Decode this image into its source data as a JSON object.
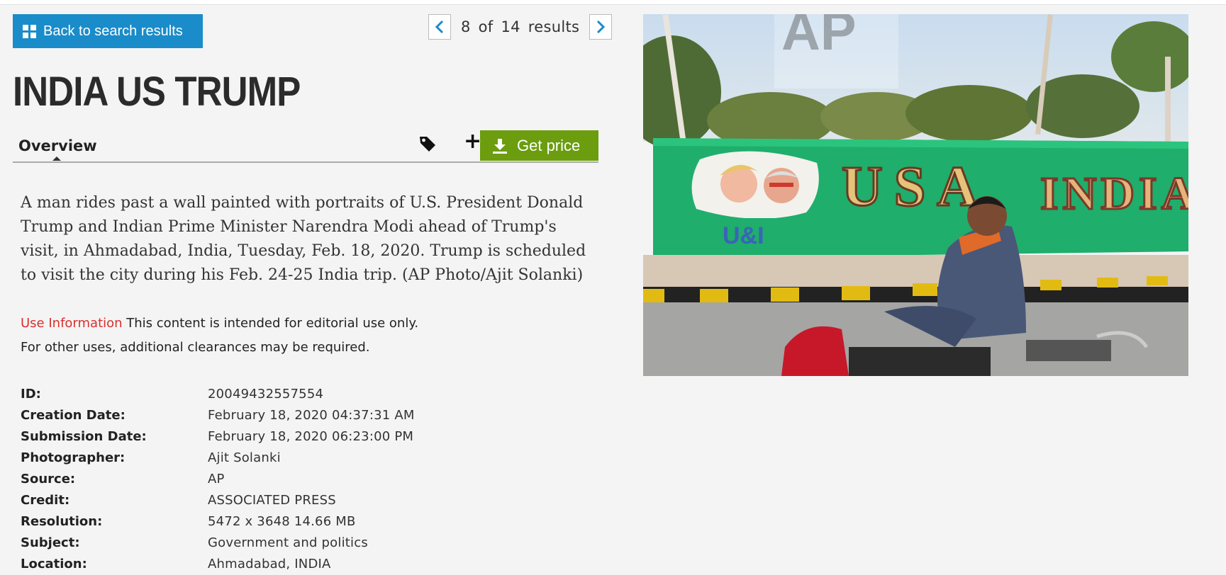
{
  "nav": {
    "back_label": "Back to search results",
    "pager": {
      "current": "8",
      "of": "of",
      "total": "14",
      "word": "results"
    }
  },
  "title": "INDIA US TRUMP",
  "tabs": {
    "overview": "Overview",
    "get_price": "Get price"
  },
  "caption": "A man rides past a wall painted with portraits of U.S. President Donald Trump and Indian Prime Minister Narendra Modi ahead of Trump's visit, in Ahmadabad, India, Tuesday, Feb. 18, 2020. Trump is scheduled to visit the city during his Feb. 24-25 India trip. (AP Photo/Ajit Solanki)",
  "use_info": {
    "label": "Use Information",
    "text1": "This content is intended for editorial use only.",
    "text2": "For other uses, additional clearances may be required."
  },
  "metadata": [
    {
      "key": "ID:",
      "value": "20049432557554"
    },
    {
      "key": "Creation Date:",
      "value": "February 18, 2020 04:37:31 AM"
    },
    {
      "key": "Submission Date:",
      "value": "February 18, 2020 06:23:00 PM"
    },
    {
      "key": "Photographer:",
      "value": "Ajit Solanki"
    },
    {
      "key": "Source:",
      "value": "AP"
    },
    {
      "key": "Credit:",
      "value": "ASSOCIATED PRESS"
    },
    {
      "key": "Resolution:",
      "value": "5472 x 3648 14.66 MB"
    },
    {
      "key": "Subject:",
      "value": "Government and politics"
    },
    {
      "key": "Location:",
      "value": "Ahmadabad, INDIA"
    }
  ],
  "photo": {
    "watermark": "AP",
    "wall_text_left": "USA",
    "wall_text_right": "INDIA",
    "badge_text": "U&I"
  },
  "colors": {
    "accent_blue": "#1a8cc9",
    "price_green": "#6b9d0f",
    "use_info_red": "#d9302c"
  }
}
